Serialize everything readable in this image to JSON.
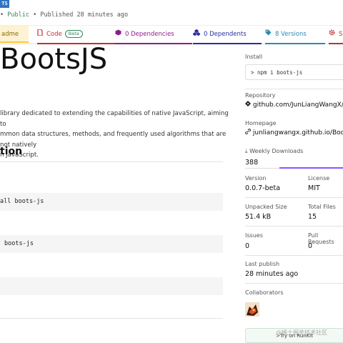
{
  "header": {
    "lang_badge": "TS",
    "bullet1": "•",
    "visibility": "Public",
    "published": "• Published 28 minutes ago"
  },
  "tabs": [
    {
      "label": "adme",
      "icon": "readme-icon",
      "color": "#ffc83d"
    },
    {
      "label": "Code",
      "badge": "Beta",
      "icon": "code-icon",
      "color": "#c4302b"
    },
    {
      "label": "0 Dependencies",
      "icon": "box-icon",
      "color": "#8f1a8f"
    },
    {
      "label": "0 Dependents",
      "icon": "cubes-icon",
      "color": "#2c2ca3"
    },
    {
      "label": "8 Versions",
      "icon": "tag-icon",
      "color": "#2a8ab0"
    },
    {
      "label": "S",
      "icon": "gear-icon",
      "color": "#c4302b"
    }
  ],
  "main": {
    "title": "BootsJS",
    "description": [
      "library dedicated to extending the capabilities of native JavaScript, aiming to",
      "mmon data structures, methods, and frequently used algorithms that are not natively",
      "n JavaScript."
    ],
    "section_heading": "tion",
    "code_blocks": [
      "all boots-js",
      "boots-js",
      ""
    ]
  },
  "sidebar": {
    "install_label": "Install",
    "install_cmd": "> npm i boots-js",
    "repository_label": "Repository",
    "repository_value": "github.com/JunLiangWangX/Boot",
    "homepage_label": "Homepage",
    "homepage_value": "junliangwangx.github.io/BootsJS",
    "weekly_label": "Weekly Downloads",
    "weekly_value": "388",
    "version_label": "Version",
    "version_value": "0.0.7-beta",
    "license_label": "License",
    "license_value": "MIT",
    "size_label": "Unpacked Size",
    "size_value": "51.4 kB",
    "files_label": "Total Files",
    "files_value": "15",
    "issues_label": "Issues",
    "issues_value": "0",
    "prs_label": "Pull Requests",
    "prs_value": "0",
    "last_publish_label": "Last publish",
    "last_publish_value": "28 minutes ago",
    "collaborators_label": "Collaborators",
    "runkit_label": ">Try on RunKit"
  },
  "watermark": "@稀土掘金技术社区"
}
